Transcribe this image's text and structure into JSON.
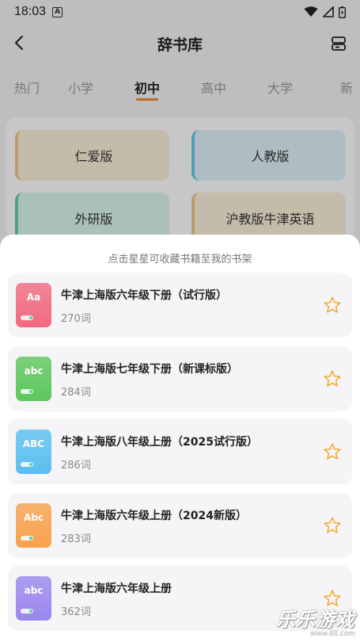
{
  "status_bar": {
    "time": "18:03",
    "notification_badge": "A"
  },
  "header": {
    "title": "辞书库"
  },
  "tabs": [
    {
      "label": "热门"
    },
    {
      "label": "小学"
    },
    {
      "label": "初中",
      "active": true
    },
    {
      "label": "高中"
    },
    {
      "label": "大学"
    },
    {
      "label": "新"
    }
  ],
  "editions": [
    {
      "label": "仁爱版"
    },
    {
      "label": "人教版"
    },
    {
      "label": "外研版"
    },
    {
      "label": "沪教版牛津英语"
    }
  ],
  "sheet": {
    "hint": "点击星星可收藏书籍至我的书架",
    "books": [
      {
        "cover_text": "Aa",
        "cover_color": "#f2697f",
        "title": "牛津上海版六年级下册（试行版）",
        "count": "270词",
        "favorited": false
      },
      {
        "cover_text": "abc",
        "cover_color": "#5cc75b",
        "title": "牛津上海版七年级下册（新课标版）",
        "count": "284词",
        "favorited": false
      },
      {
        "cover_text": "ABC",
        "cover_color": "#5bbff0",
        "title": "牛津上海版八年级上册（2025试行版）",
        "count": "286词",
        "favorited": false
      },
      {
        "cover_text": "Abc",
        "cover_color": "#f7a14c",
        "title": "牛津上海版六年级上册（2024新版）",
        "count": "283词",
        "favorited": false
      },
      {
        "cover_text": "abc",
        "cover_color": "#9b87ee",
        "title": "牛津上海版六年级上册",
        "count": "362词",
        "favorited": false
      }
    ]
  },
  "icons": {
    "back": "back-arrow-icon",
    "shelf": "bookshelf-icon",
    "star": "star-outline-icon",
    "wifi": "wifi-icon",
    "signal": "signal-icon",
    "battery": "battery-icon"
  },
  "colors": {
    "accent": "#f08b24",
    "star": "#f5a623"
  },
  "watermark": {
    "text": "乐乐游戏",
    "url": "www.6ll.com"
  }
}
